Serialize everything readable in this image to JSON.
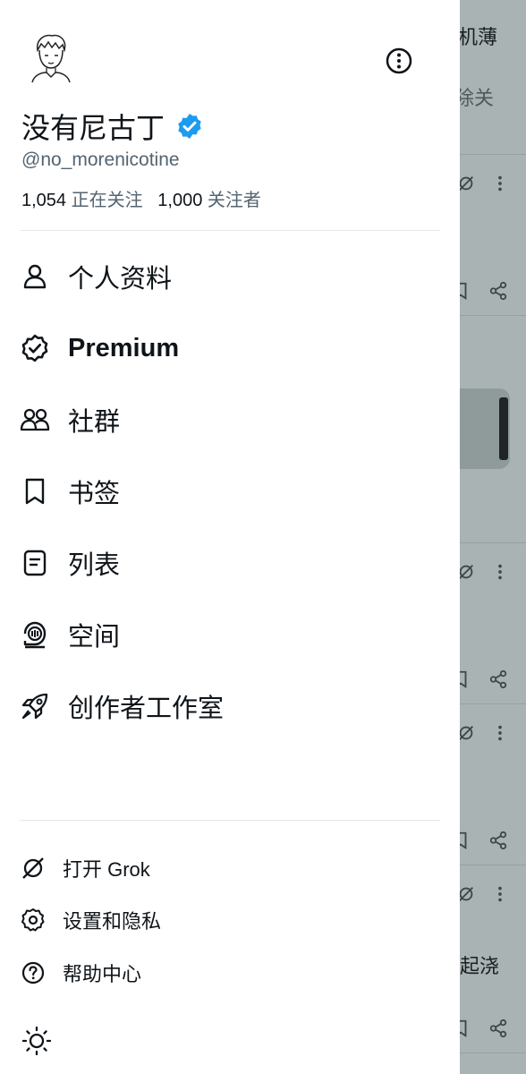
{
  "profile": {
    "name": "没有尼古丁",
    "handle": "@no_morenicotine",
    "following_count": "1,054",
    "following_label": "正在关注",
    "followers_count": "1,000",
    "followers_label": "关注者"
  },
  "nav": {
    "items": [
      {
        "label": "个人资料",
        "icon": "person-icon"
      },
      {
        "label": "Premium",
        "icon": "premium-icon"
      },
      {
        "label": "社群",
        "icon": "communities-icon"
      },
      {
        "label": "书签",
        "icon": "bookmark-icon"
      },
      {
        "label": "列表",
        "icon": "list-icon"
      },
      {
        "label": "空间",
        "icon": "spaces-icon"
      },
      {
        "label": "创作者工作室",
        "icon": "rocket-icon"
      }
    ]
  },
  "secondary": {
    "items": [
      {
        "label": "打开 Grok",
        "icon": "grok-icon"
      },
      {
        "label": "设置和隐私",
        "icon": "gear-icon"
      },
      {
        "label": "帮助中心",
        "icon": "help-icon"
      }
    ]
  },
  "background_timeline": {
    "texts": [
      "机薄",
      "除关",
      "起浇"
    ]
  },
  "colors": {
    "verified_badge": "#1d9bf0",
    "text_primary": "#0f1419",
    "text_secondary": "#536471",
    "overlay": "#a9b3b3"
  }
}
